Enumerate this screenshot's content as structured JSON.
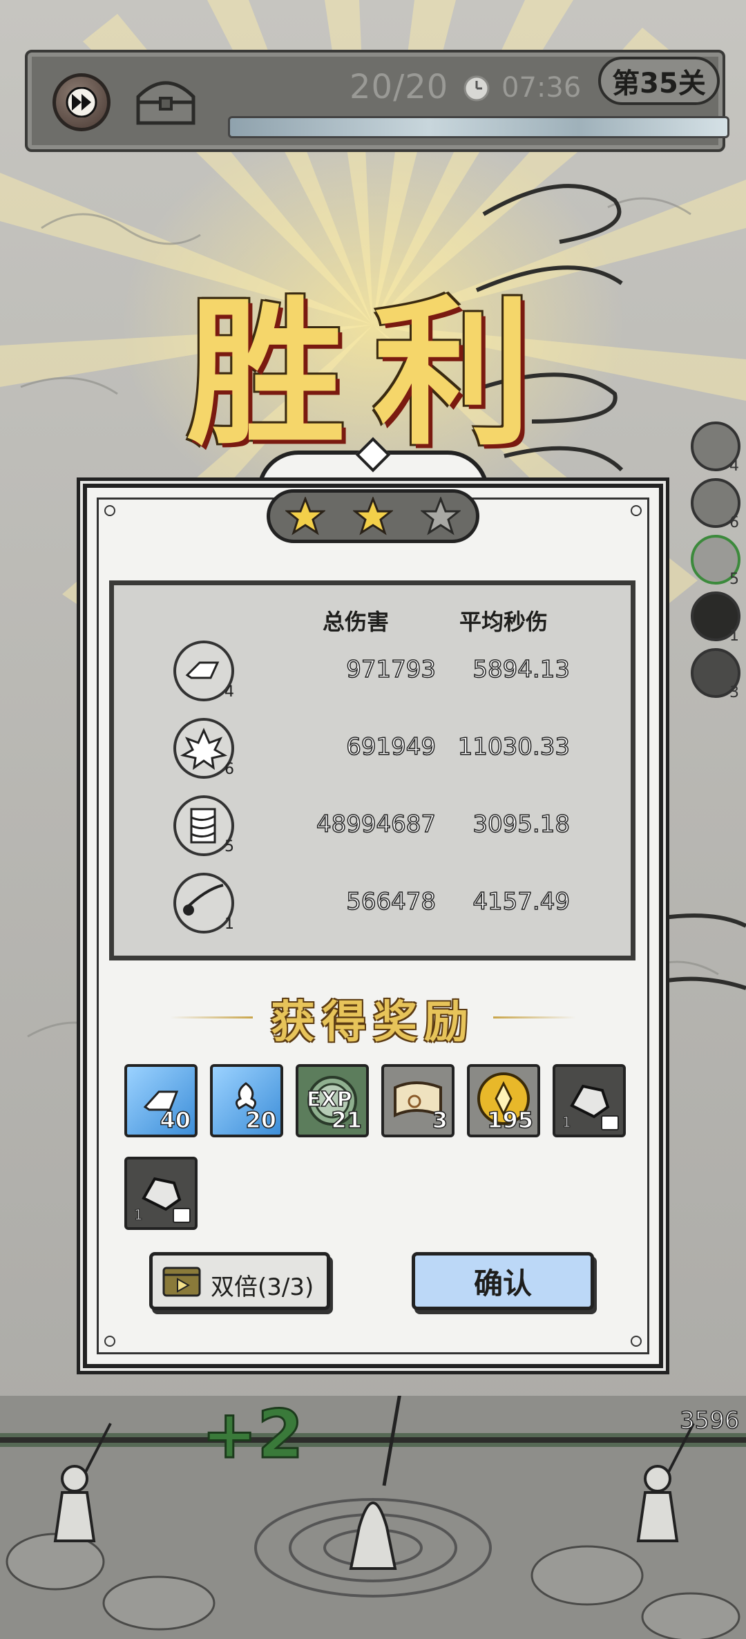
{
  "hud": {
    "wave": "20/20",
    "timer": "07:36",
    "level": "第35关",
    "icons": [
      "fast-forward-icon",
      "treasure-chest-icon",
      "clock-icon"
    ]
  },
  "title": "胜利",
  "stars": {
    "earned": 2,
    "total": 3
  },
  "stats": {
    "headers": {
      "total_damage": "总伤害",
      "dps": "平均秒伤"
    },
    "rows": [
      {
        "icon": "crystal-shard-skill-icon",
        "level": "4",
        "total": "971793",
        "dps": "5894.13"
      },
      {
        "icon": "ice-burst-skill-icon",
        "level": "6",
        "total": "691949",
        "dps": "11030.33"
      },
      {
        "icon": "tornado-skill-icon",
        "level": "5",
        "total": "48994687",
        "dps": "3095.18"
      },
      {
        "icon": "comet-skill-icon",
        "level": "1",
        "total": "566478",
        "dps": "4157.49"
      }
    ]
  },
  "side_skills": [
    {
      "icon": "crystal-shard-skill-icon",
      "level": "4"
    },
    {
      "icon": "ice-burst-skill-icon",
      "level": "6"
    },
    {
      "icon": "tornado-skill-icon",
      "level": "5"
    },
    {
      "icon": "comet-skill-icon",
      "level": "1"
    },
    {
      "icon": "slash-skill-icon",
      "level": "3"
    }
  ],
  "rewards_title": "获得奖励",
  "rewards": [
    {
      "icon": "blue-crystal-card-icon",
      "count": "40"
    },
    {
      "icon": "blue-ice-card-icon",
      "count": "20"
    },
    {
      "icon": "exp-orb-icon",
      "count": "21",
      "label": "EXP"
    },
    {
      "icon": "scroll-icon",
      "count": "3"
    },
    {
      "icon": "gold-coin-icon",
      "count": "195"
    },
    {
      "icon": "silver-ore-icon",
      "count": "1"
    },
    {
      "icon": "silver-ore-icon",
      "count": "1"
    }
  ],
  "buttons": {
    "double": "双倍(3/3)",
    "confirm": "确认"
  },
  "battle": {
    "gain": "+2",
    "wall_hp": "3596"
  },
  "colors": {
    "gold": "#f5d66a",
    "confirm_blue": "#bcd8f7",
    "gain_green": "#3a7a3a"
  }
}
